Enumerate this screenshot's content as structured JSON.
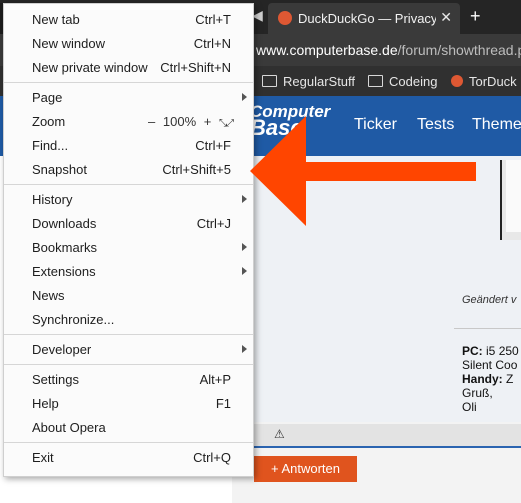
{
  "browser": {
    "active_tab_title": "DuckDuckGo — Privacy, s",
    "tab_close_icon": "close-icon",
    "new_tab_icon": "plus-icon",
    "url_host": "www.computerbase.de",
    "url_path": "/forum/showthread.ph",
    "bookmarks": [
      {
        "label": "RegularStuff",
        "icon": "folder-icon"
      },
      {
        "label": "Codeing",
        "icon": "folder-icon"
      },
      {
        "label": "TorDuck",
        "icon": "duckduckgo-icon"
      }
    ]
  },
  "site": {
    "logo_line1": "Computer",
    "logo_line2": "Base",
    "nav": [
      "Ticker",
      "Tests",
      "Theme"
    ],
    "edited_text": "Geändert v",
    "signature": {
      "pc_label": "PC:",
      "pc_value": "i5 250",
      "line2": "Silent Coo",
      "handy_label": "Handy:",
      "handy_value": "Z",
      "line4": "Gruß,",
      "line5": "Oli"
    },
    "warning_icon": "warning-icon",
    "reply_button": "+ Antworten",
    "colors": {
      "header": "#1f5aa5",
      "reply": "#e0541e"
    }
  },
  "menu": {
    "items": [
      {
        "label": "New tab",
        "shortcut": "Ctrl+T"
      },
      {
        "label": "New window",
        "shortcut": "Ctrl+N"
      },
      {
        "label": "New private window",
        "shortcut": "Ctrl+Shift+N"
      },
      {
        "label": "Page",
        "shortcut": ""
      },
      {
        "label": "Zoom",
        "shortcut": ""
      },
      {
        "label": "Find...",
        "shortcut": "Ctrl+F"
      },
      {
        "label": "Snapshot",
        "shortcut": "Ctrl+Shift+5"
      },
      {
        "label": "History",
        "shortcut": ""
      },
      {
        "label": "Downloads",
        "shortcut": "Ctrl+J"
      },
      {
        "label": "Bookmarks",
        "shortcut": ""
      },
      {
        "label": "Extensions",
        "shortcut": ""
      },
      {
        "label": "News",
        "shortcut": ""
      },
      {
        "label": "Synchronize...",
        "shortcut": ""
      },
      {
        "label": "Developer",
        "shortcut": ""
      },
      {
        "label": "Settings",
        "shortcut": "Alt+P"
      },
      {
        "label": "Help",
        "shortcut": "F1"
      },
      {
        "label": "About Opera",
        "shortcut": ""
      },
      {
        "label": "Exit",
        "shortcut": "Ctrl+Q"
      }
    ],
    "zoom": {
      "minus": "–",
      "level": "100%",
      "plus": "+"
    }
  },
  "annotation": {
    "color": "#ff4500"
  }
}
